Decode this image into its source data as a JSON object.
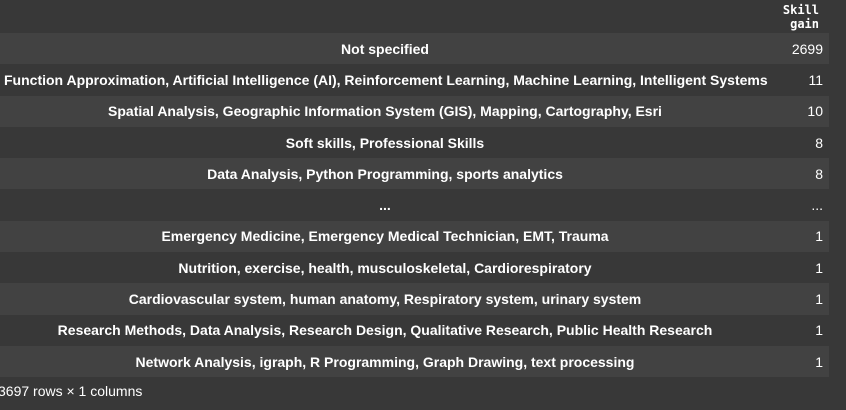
{
  "table": {
    "column_header": "Skill gain",
    "rows": [
      {
        "index": "Not specified",
        "value": "2699"
      },
      {
        "index": "Function Approximation, Artificial Intelligence (AI), Reinforcement Learning, Machine Learning, Intelligent Systems",
        "value": "11"
      },
      {
        "index": "Spatial Analysis, Geographic Information System (GIS), Mapping, Cartography, Esri",
        "value": "10"
      },
      {
        "index": "Soft skills, Professional Skills",
        "value": "8"
      },
      {
        "index": "Data Analysis, Python Programming, sports analytics",
        "value": "8"
      },
      {
        "index": "...",
        "value": "..."
      },
      {
        "index": "Emergency Medicine, Emergency Medical Technician, EMT, Trauma",
        "value": "1"
      },
      {
        "index": "Nutrition, exercise, health, musculoskeletal, Cardiorespiratory",
        "value": "1"
      },
      {
        "index": "Cardiovascular system, human anatomy, Respiratory system, urinary system",
        "value": "1"
      },
      {
        "index": "Research Methods, Data Analysis, Research Design, Qualitative Research, Public Health Research",
        "value": "1"
      },
      {
        "index": "Network Analysis, igraph, R Programming, Graph Drawing, text processing",
        "value": "1"
      }
    ]
  },
  "footer": {
    "shape_text": "3697 rows × 1 columns"
  }
}
